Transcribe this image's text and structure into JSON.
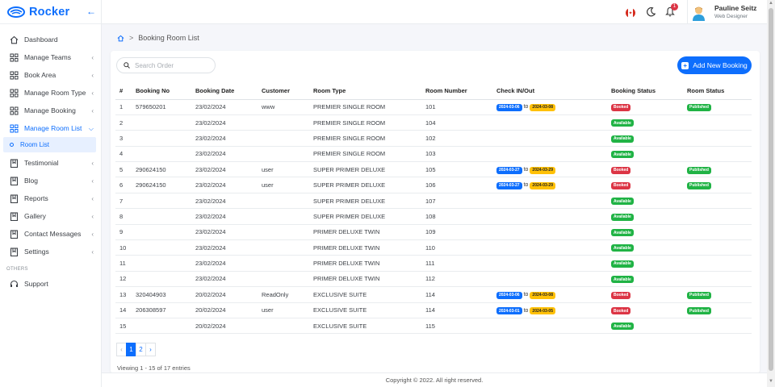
{
  "brand": {
    "name": "Rocker"
  },
  "sidebar": {
    "items": [
      {
        "label": "Dashboard",
        "icon": "home-icon",
        "arrow": false
      },
      {
        "label": "Manage Teams",
        "icon": "grid-icon",
        "arrow": true
      },
      {
        "label": "Book Area",
        "icon": "grid-icon",
        "arrow": true
      },
      {
        "label": "Manage Room Type",
        "icon": "grid-icon",
        "arrow": true
      },
      {
        "label": "Manage Booking",
        "icon": "grid-icon",
        "arrow": true
      },
      {
        "label": "Manage Room List",
        "icon": "grid-icon",
        "arrow": true,
        "active": true
      }
    ],
    "sub_item": "Room List",
    "items2": [
      {
        "label": "Testimonial",
        "icon": "bookmark-icon"
      },
      {
        "label": "Blog",
        "icon": "bookmark-icon"
      },
      {
        "label": "Reports",
        "icon": "bookmark-icon"
      },
      {
        "label": "Gallery",
        "icon": "bookmark-icon"
      },
      {
        "label": "Contact Messages",
        "icon": "bookmark-icon"
      },
      {
        "label": "Settings",
        "icon": "bookmark-icon"
      }
    ],
    "others_label": "OTHERS",
    "support_label": "Support"
  },
  "topbar": {
    "notification_count": "1",
    "user_name": "Pauline Seitz",
    "user_role": "Web Designer"
  },
  "breadcrumb": {
    "current": "Booking Room List"
  },
  "search": {
    "placeholder": "Search Order"
  },
  "add_button": {
    "label": "Add New Booking"
  },
  "table": {
    "columns": [
      "#",
      "Booking No",
      "Booking Date",
      "Customer",
      "Room Type",
      "Room Number",
      "Check IN/Out",
      "Booking Status",
      "Room Status"
    ],
    "to_label": "to",
    "rows": [
      {
        "n": "1",
        "booking_no": "579650201",
        "date": "23/02/2024",
        "customer": "www",
        "room_type": "PREMIER SINGLE ROOM",
        "room_number": "101",
        "check_in": "2024-03-06",
        "check_out": "2024-03-08",
        "booking_status": "Booked",
        "room_status": "Published"
      },
      {
        "n": "2",
        "booking_no": "",
        "date": "23/02/2024",
        "customer": "",
        "room_type": "PREMIER SINGLE ROOM",
        "room_number": "104",
        "check_in": "",
        "check_out": "",
        "booking_status": "Available",
        "room_status": ""
      },
      {
        "n": "3",
        "booking_no": "",
        "date": "23/02/2024",
        "customer": "",
        "room_type": "PREMIER SINGLE ROOM",
        "room_number": "102",
        "check_in": "",
        "check_out": "",
        "booking_status": "Available",
        "room_status": ""
      },
      {
        "n": "4",
        "booking_no": "",
        "date": "23/02/2024",
        "customer": "",
        "room_type": "PREMIER SINGLE ROOM",
        "room_number": "103",
        "check_in": "",
        "check_out": "",
        "booking_status": "Available",
        "room_status": ""
      },
      {
        "n": "5",
        "booking_no": "290624150",
        "date": "23/02/2024",
        "customer": "user",
        "room_type": "SUPER PRIMER DELUXE",
        "room_number": "105",
        "check_in": "2024-03-27",
        "check_out": "2024-03-29",
        "booking_status": "Booked",
        "room_status": "Published"
      },
      {
        "n": "6",
        "booking_no": "290624150",
        "date": "23/02/2024",
        "customer": "user",
        "room_type": "SUPER PRIMER DELUXE",
        "room_number": "106",
        "check_in": "2024-03-27",
        "check_out": "2024-03-29",
        "booking_status": "Booked",
        "room_status": "Published"
      },
      {
        "n": "7",
        "booking_no": "",
        "date": "23/02/2024",
        "customer": "",
        "room_type": "SUPER PRIMER DELUXE",
        "room_number": "107",
        "check_in": "",
        "check_out": "",
        "booking_status": "Available",
        "room_status": ""
      },
      {
        "n": "8",
        "booking_no": "",
        "date": "23/02/2024",
        "customer": "",
        "room_type": "SUPER PRIMER DELUXE",
        "room_number": "108",
        "check_in": "",
        "check_out": "",
        "booking_status": "Available",
        "room_status": ""
      },
      {
        "n": "9",
        "booking_no": "",
        "date": "23/02/2024",
        "customer": "",
        "room_type": "PRIMER DELUXE TWIN",
        "room_number": "109",
        "check_in": "",
        "check_out": "",
        "booking_status": "Available",
        "room_status": ""
      },
      {
        "n": "10",
        "booking_no": "",
        "date": "23/02/2024",
        "customer": "",
        "room_type": "PRIMER DELUXE TWIN",
        "room_number": "110",
        "check_in": "",
        "check_out": "",
        "booking_status": "Available",
        "room_status": ""
      },
      {
        "n": "11",
        "booking_no": "",
        "date": "23/02/2024",
        "customer": "",
        "room_type": "PRIMER DELUXE TWIN",
        "room_number": "111",
        "check_in": "",
        "check_out": "",
        "booking_status": "Available",
        "room_status": ""
      },
      {
        "n": "12",
        "booking_no": "",
        "date": "23/02/2024",
        "customer": "",
        "room_type": "PRIMER DELUXE TWIN",
        "room_number": "112",
        "check_in": "",
        "check_out": "",
        "booking_status": "Available",
        "room_status": ""
      },
      {
        "n": "13",
        "booking_no": "320404903",
        "date": "20/02/2024",
        "customer": "ReadOnly",
        "room_type": "EXCLUSIVE SUITE",
        "room_number": "114",
        "check_in": "2024-03-06",
        "check_out": "2024-03-08",
        "booking_status": "Booked",
        "room_status": "Published"
      },
      {
        "n": "14",
        "booking_no": "206308597",
        "date": "20/02/2024",
        "customer": "user",
        "room_type": "EXCLUSIVE SUITE",
        "room_number": "114",
        "check_in": "2024-03-01",
        "check_out": "2024-03-05",
        "booking_status": "Booked",
        "room_status": "Published"
      },
      {
        "n": "15",
        "booking_no": "",
        "date": "20/02/2024",
        "customer": "",
        "room_type": "EXCLUSIVE SUITE",
        "room_number": "115",
        "check_in": "",
        "check_out": "",
        "booking_status": "Available",
        "room_status": ""
      }
    ]
  },
  "pagination": {
    "prev": "‹",
    "pages": [
      "1",
      "2"
    ],
    "next": "›",
    "active": "1"
  },
  "entries_text": "Viewing 1 - 15 of 17 entries",
  "footer": {
    "text": "Copyright © 2022. All right reserved."
  },
  "colors": {
    "primary": "#0d6efd",
    "booked": "#dc3545",
    "available": "#20b345",
    "checkout": "#ffc107"
  }
}
